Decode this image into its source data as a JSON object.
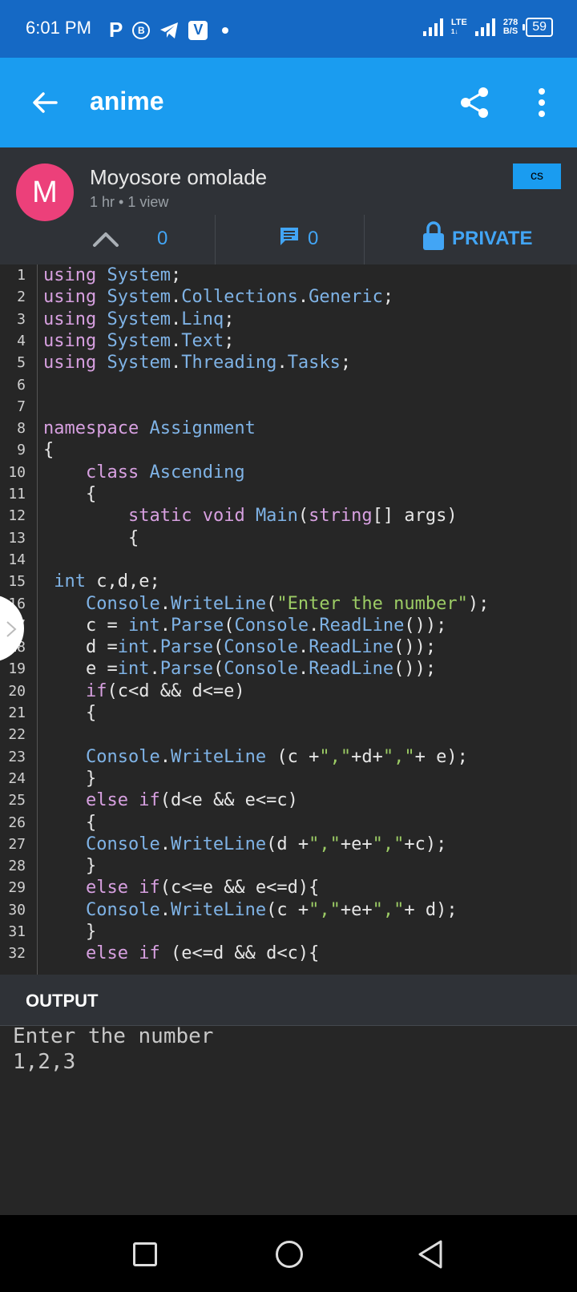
{
  "status_bar": {
    "time": "6:01 PM",
    "app_icons": [
      "P",
      "B",
      "telegram-icon",
      "V"
    ],
    "network": "LTE",
    "network_sub": "1↓",
    "speed_value": "278",
    "speed_unit": "B/S",
    "battery": "59"
  },
  "app_bar": {
    "title": "anime",
    "back_icon": "arrow-left-icon",
    "share_icon": "share-icon",
    "more_icon": "more-vert-icon"
  },
  "post": {
    "avatar_letter": "M",
    "avatar_color": "#ec407a",
    "author": "Moyosore omolade",
    "meta": "1 hr • 1 view",
    "language": "cs",
    "votes": "0",
    "comments": "0",
    "privacy": "PRIVATE"
  },
  "code": {
    "lines": [
      {
        "n": "1",
        "indent": "",
        "tokens": [
          [
            "k",
            "using"
          ],
          [
            "p",
            " "
          ],
          [
            "t",
            "System"
          ],
          [
            "p",
            ";"
          ]
        ]
      },
      {
        "n": "2",
        "indent": "",
        "tokens": [
          [
            "k",
            "using"
          ],
          [
            "p",
            " "
          ],
          [
            "t",
            "System"
          ],
          [
            "p",
            "."
          ],
          [
            "t",
            "Collections"
          ],
          [
            "p",
            "."
          ],
          [
            "t",
            "Generic"
          ],
          [
            "p",
            ";"
          ]
        ]
      },
      {
        "n": "3",
        "indent": "",
        "tokens": [
          [
            "k",
            "using"
          ],
          [
            "p",
            " "
          ],
          [
            "t",
            "System"
          ],
          [
            "p",
            "."
          ],
          [
            "t",
            "Linq"
          ],
          [
            "p",
            ";"
          ]
        ]
      },
      {
        "n": "4",
        "indent": "",
        "tokens": [
          [
            "k",
            "using"
          ],
          [
            "p",
            " "
          ],
          [
            "t",
            "System"
          ],
          [
            "p",
            "."
          ],
          [
            "t",
            "Text"
          ],
          [
            "p",
            ";"
          ]
        ]
      },
      {
        "n": "5",
        "indent": "",
        "tokens": [
          [
            "k",
            "using"
          ],
          [
            "p",
            " "
          ],
          [
            "t",
            "System"
          ],
          [
            "p",
            "."
          ],
          [
            "t",
            "Threading"
          ],
          [
            "p",
            "."
          ],
          [
            "t",
            "Tasks"
          ],
          [
            "p",
            ";"
          ]
        ]
      },
      {
        "n": "6",
        "indent": "",
        "tokens": []
      },
      {
        "n": "7",
        "indent": "",
        "tokens": []
      },
      {
        "n": "8",
        "indent": "",
        "tokens": [
          [
            "k",
            "namespace"
          ],
          [
            "p",
            " "
          ],
          [
            "t",
            "Assignment"
          ]
        ]
      },
      {
        "n": "9",
        "indent": "",
        "tokens": [
          [
            "p",
            "{"
          ]
        ]
      },
      {
        "n": "10",
        "indent": "    ",
        "tokens": [
          [
            "k",
            "class"
          ],
          [
            "p",
            " "
          ],
          [
            "t",
            "Ascending"
          ]
        ]
      },
      {
        "n": "11",
        "indent": "    ",
        "tokens": [
          [
            "p",
            "{"
          ]
        ]
      },
      {
        "n": "12",
        "indent": "        ",
        "tokens": [
          [
            "k",
            "static"
          ],
          [
            "p",
            " "
          ],
          [
            "k",
            "void"
          ],
          [
            "p",
            " "
          ],
          [
            "t",
            "Main"
          ],
          [
            "p",
            "("
          ],
          [
            "k",
            "string"
          ],
          [
            "p",
            "[] args)"
          ]
        ]
      },
      {
        "n": "13",
        "indent": "        ",
        "tokens": [
          [
            "p",
            "{"
          ]
        ]
      },
      {
        "n": "14",
        "indent": "",
        "tokens": []
      },
      {
        "n": "15",
        "indent": " ",
        "tokens": [
          [
            "t",
            "int"
          ],
          [
            "p",
            " c,d,e;"
          ]
        ]
      },
      {
        "n": "16",
        "indent": "    ",
        "tokens": [
          [
            "t",
            "Console"
          ],
          [
            "p",
            "."
          ],
          [
            "t",
            "WriteLine"
          ],
          [
            "p",
            "("
          ],
          [
            "s",
            "\"Enter the number\""
          ],
          [
            "p",
            ");"
          ]
        ]
      },
      {
        "n": "17",
        "indent": "    ",
        "tokens": [
          [
            "p",
            "c = "
          ],
          [
            "t",
            "int"
          ],
          [
            "p",
            "."
          ],
          [
            "t",
            "Parse"
          ],
          [
            "p",
            "("
          ],
          [
            "t",
            "Console"
          ],
          [
            "p",
            "."
          ],
          [
            "t",
            "ReadLine"
          ],
          [
            "p",
            "());"
          ]
        ]
      },
      {
        "n": "18",
        "indent": "    ",
        "tokens": [
          [
            "p",
            "d ="
          ],
          [
            "t",
            "int"
          ],
          [
            "p",
            "."
          ],
          [
            "t",
            "Parse"
          ],
          [
            "p",
            "("
          ],
          [
            "t",
            "Console"
          ],
          [
            "p",
            "."
          ],
          [
            "t",
            "ReadLine"
          ],
          [
            "p",
            "());"
          ]
        ]
      },
      {
        "n": "19",
        "indent": "    ",
        "tokens": [
          [
            "p",
            "e ="
          ],
          [
            "t",
            "int"
          ],
          [
            "p",
            "."
          ],
          [
            "t",
            "Parse"
          ],
          [
            "p",
            "("
          ],
          [
            "t",
            "Console"
          ],
          [
            "p",
            "."
          ],
          [
            "t",
            "ReadLine"
          ],
          [
            "p",
            "());"
          ]
        ]
      },
      {
        "n": "20",
        "indent": "    ",
        "tokens": [
          [
            "k",
            "if"
          ],
          [
            "p",
            "(c<d && d<=e)"
          ]
        ]
      },
      {
        "n": "21",
        "indent": "    ",
        "tokens": [
          [
            "p",
            "{"
          ]
        ]
      },
      {
        "n": "22",
        "indent": "",
        "tokens": []
      },
      {
        "n": "23",
        "indent": "    ",
        "tokens": [
          [
            "t",
            "Console"
          ],
          [
            "p",
            "."
          ],
          [
            "t",
            "WriteLine"
          ],
          [
            "p",
            " (c +"
          ],
          [
            "s",
            "\",\""
          ],
          [
            "p",
            "+d+"
          ],
          [
            "s",
            "\",\""
          ],
          [
            "p",
            "+ e);"
          ]
        ]
      },
      {
        "n": "24",
        "indent": "    ",
        "tokens": [
          [
            "p",
            "}"
          ]
        ]
      },
      {
        "n": "25",
        "indent": "    ",
        "tokens": [
          [
            "k",
            "else"
          ],
          [
            "p",
            " "
          ],
          [
            "k",
            "if"
          ],
          [
            "p",
            "(d<e && e<=c)"
          ]
        ]
      },
      {
        "n": "26",
        "indent": "    ",
        "tokens": [
          [
            "p",
            "{"
          ]
        ]
      },
      {
        "n": "27",
        "indent": "    ",
        "tokens": [
          [
            "t",
            "Console"
          ],
          [
            "p",
            "."
          ],
          [
            "t",
            "WriteLine"
          ],
          [
            "p",
            "(d +"
          ],
          [
            "s",
            "\",\""
          ],
          [
            "p",
            "+e+"
          ],
          [
            "s",
            "\",\""
          ],
          [
            "p",
            "+c);"
          ]
        ]
      },
      {
        "n": "28",
        "indent": "    ",
        "tokens": [
          [
            "p",
            "}"
          ]
        ]
      },
      {
        "n": "29",
        "indent": "    ",
        "tokens": [
          [
            "k",
            "else"
          ],
          [
            "p",
            " "
          ],
          [
            "k",
            "if"
          ],
          [
            "p",
            "(c<=e && e<=d){"
          ]
        ]
      },
      {
        "n": "30",
        "indent": "    ",
        "tokens": [
          [
            "t",
            "Console"
          ],
          [
            "p",
            "."
          ],
          [
            "t",
            "WriteLine"
          ],
          [
            "p",
            "(c +"
          ],
          [
            "s",
            "\",\""
          ],
          [
            "p",
            "+e+"
          ],
          [
            "s",
            "\",\""
          ],
          [
            "p",
            "+ d);"
          ]
        ]
      },
      {
        "n": "31",
        "indent": "    ",
        "tokens": [
          [
            "p",
            "}"
          ]
        ]
      },
      {
        "n": "32",
        "indent": "    ",
        "tokens": [
          [
            "k",
            "else"
          ],
          [
            "p",
            " "
          ],
          [
            "k",
            "if"
          ],
          [
            "p",
            " (e<=d && d<c){"
          ]
        ]
      }
    ]
  },
  "output": {
    "title": "OUTPUT",
    "lines": [
      "Enter the number",
      "1,2,3"
    ]
  },
  "nav_bar": {
    "recent_icon": "square-icon",
    "home_icon": "circle-icon",
    "back_icon": "triangle-back-icon"
  }
}
